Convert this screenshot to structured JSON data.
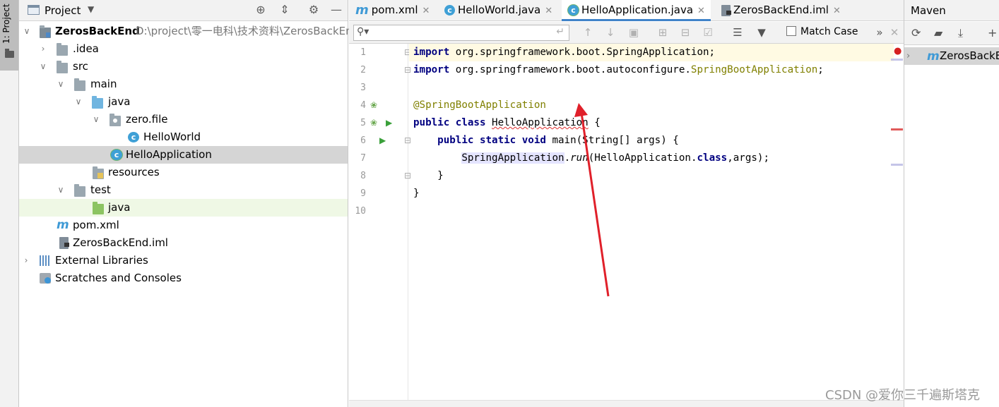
{
  "sidebar_strip": {
    "label": "1: Project"
  },
  "project_panel": {
    "title": "Project",
    "tree": [
      {
        "label": "ZerosBackEnd",
        "path": "D:\\project\\零一电科\\技术资料\\ZerosBackEn"
      },
      {
        "label": ".idea"
      },
      {
        "label": "src"
      },
      {
        "label": "main"
      },
      {
        "label": "java"
      },
      {
        "label": "zero.file"
      },
      {
        "label": "HelloWorld"
      },
      {
        "label": "HelloApplication"
      },
      {
        "label": "resources"
      },
      {
        "label": "test"
      },
      {
        "label": "java"
      },
      {
        "label": "pom.xml"
      },
      {
        "label": "ZerosBackEnd.iml"
      },
      {
        "label": "External Libraries"
      },
      {
        "label": "Scratches and Consoles"
      }
    ]
  },
  "editor": {
    "tabs": [
      {
        "label": "pom.xml"
      },
      {
        "label": "HelloWorld.java"
      },
      {
        "label": "HelloApplication.java"
      },
      {
        "label": "ZerosBackEnd.iml"
      }
    ],
    "find": {
      "match_case": "Match Case",
      "placeholder": ""
    },
    "line_numbers": [
      "1",
      "2",
      "3",
      "4",
      "5",
      "6",
      "7",
      "8",
      "9",
      "10"
    ],
    "code": {
      "l1_kw": "import",
      "l1_rest": " org.springframework.boot.SpringApplication;",
      "l2_kw": "import",
      "l2_rest": " org.springframework.boot.autoconfigure.",
      "l2_cls": "SpringBootApplication",
      "l2_end": ";",
      "l4_ann": "@SpringBootApplication",
      "l5_kw": "public class ",
      "l5_name": "HelloApplication",
      "l5_end": " {",
      "l6_indent": "    ",
      "l6_kw": "public static void ",
      "l6_rest": "main(String[] args) {",
      "l7_indent": "        ",
      "l7_cls": "SpringApplication",
      "l7_dot": ".",
      "l7_run": "run",
      "l7_mid": "(HelloApplication.",
      "l7_kw": "class",
      "l7_end": ",args);",
      "l8": "    }",
      "l9": "}"
    }
  },
  "maven_panel": {
    "title": "Maven",
    "root_item": "ZerosBackEnd"
  },
  "watermark": "CSDN @爱你三千遍斯塔克",
  "colors": {
    "accent_tab": "#4083c9",
    "annotation_arrow": "#e0202a",
    "keyword": "#000080",
    "annotation": "#808000"
  }
}
